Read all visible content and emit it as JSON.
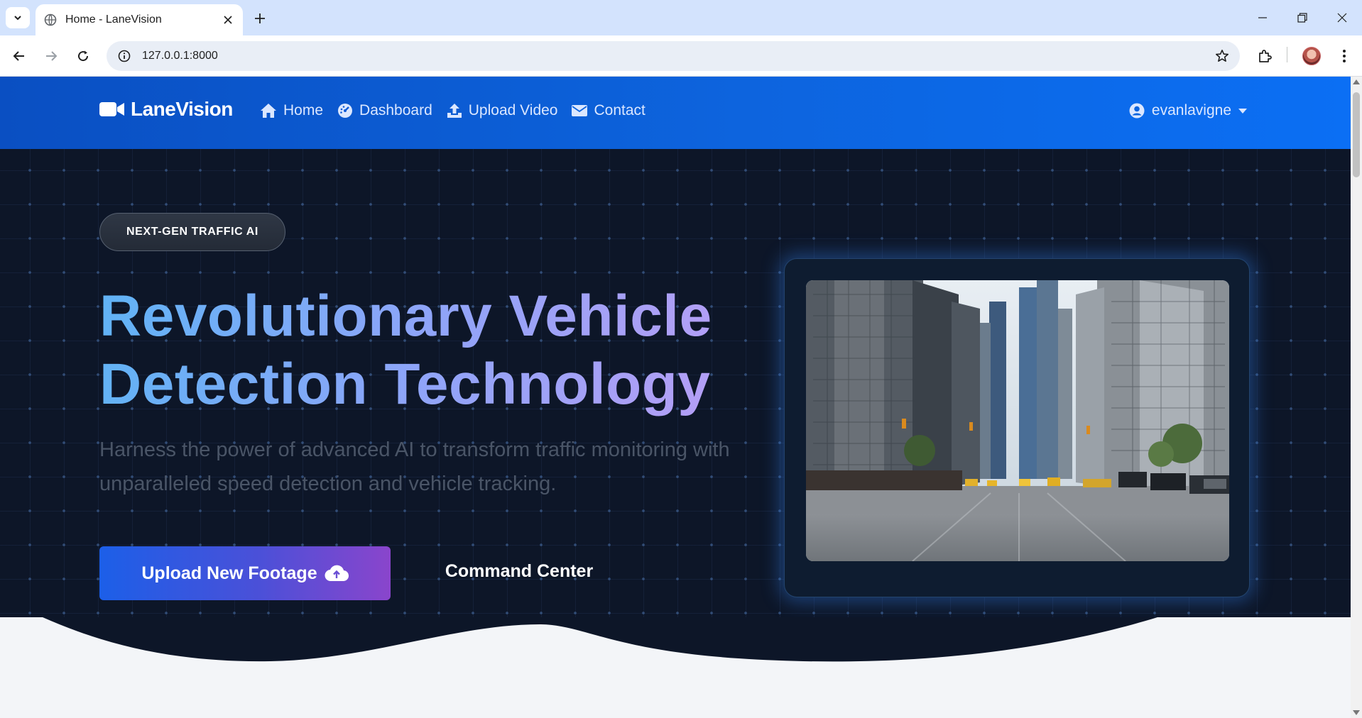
{
  "browser": {
    "tab_title": "Home - LaneVision",
    "url": "127.0.0.1:8000"
  },
  "nav": {
    "brand": "LaneVision",
    "links": [
      {
        "label": "Home",
        "icon": "home-icon"
      },
      {
        "label": "Dashboard",
        "icon": "dashboard-icon"
      },
      {
        "label": "Upload Video",
        "icon": "upload-icon"
      },
      {
        "label": "Contact",
        "icon": "envelope-icon"
      }
    ],
    "user": "evanlavigne"
  },
  "hero": {
    "badge": "NEXT-GEN TRAFFIC AI",
    "title_line1": "Revolutionary Vehicle",
    "title_line2": "Detection Technology",
    "subtitle": "Harness the power of advanced AI to transform traffic monitoring with unparalleled speed detection and vehicle tracking.",
    "primary_cta": "Upload New Footage",
    "secondary_cta": "Command Center"
  },
  "colors": {
    "nav_start": "#0a4fc2",
    "nav_end": "#0b6ff4",
    "hero_bg": "#0d1628",
    "title_gradient": [
      "#60b3f5",
      "#b99ef5"
    ],
    "cta_gradient": [
      "#1c5fe8",
      "#8a45cc"
    ],
    "section_bg": "#f3f5f8"
  }
}
